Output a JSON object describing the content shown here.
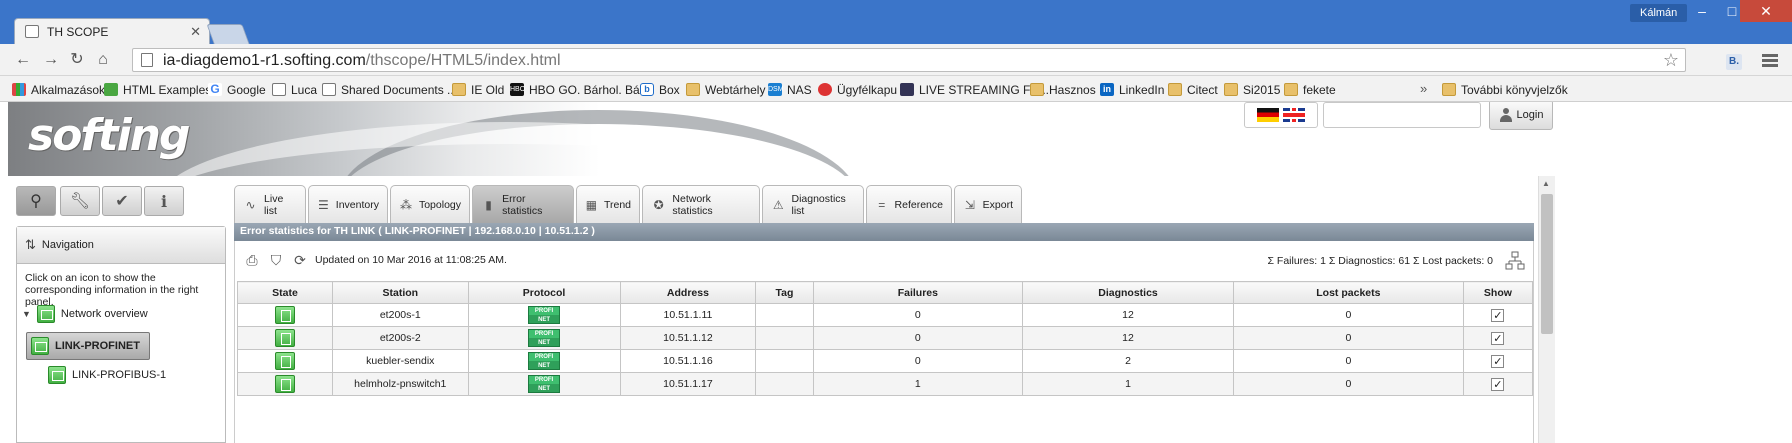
{
  "browser": {
    "tab_title": "TH SCOPE",
    "user": "Kálmán",
    "url_host": "ia-diagdemo1-r1.softing.com",
    "url_path": "/thscope/HTML5/index.html",
    "ext_label": "B.",
    "bookmarks": [
      {
        "label": "Alkalmazások",
        "icon": "apps-icon"
      },
      {
        "label": "HTML Examples",
        "icon": "w3-icon"
      },
      {
        "label": "Google",
        "icon": "google-icon"
      },
      {
        "label": "Luca",
        "icon": "page-icon"
      },
      {
        "label": "Shared Documents ...",
        "icon": "page-icon"
      },
      {
        "label": "IE Old",
        "icon": "folder-icon"
      },
      {
        "label": "HBO GO. Bárhol. Bár...",
        "icon": "hbo-icon"
      },
      {
        "label": "Box",
        "icon": "box-icon"
      },
      {
        "label": "Webtárhely",
        "icon": "folder-icon"
      },
      {
        "label": "NAS",
        "icon": "dsm-icon"
      },
      {
        "label": "Ügyfélkapu",
        "icon": "ugyfelkapu-icon"
      },
      {
        "label": "LIVE STREAMING FR...",
        "icon": "live-icon"
      },
      {
        "label": "Hasznos",
        "icon": "folder-icon"
      },
      {
        "label": "LinkedIn",
        "icon": "linkedin-icon"
      },
      {
        "label": "Citect",
        "icon": "folder-icon"
      },
      {
        "label": "Si2015",
        "icon": "folder-icon"
      },
      {
        "label": "fekete",
        "icon": "folder-icon"
      }
    ],
    "bookmarks_more": "»",
    "other_bookmarks": "További könyvjelzők"
  },
  "header": {
    "logo": "softing",
    "login_label": "Login"
  },
  "nav": {
    "title": "Navigation",
    "help": "Click on an icon to show the corresponding information in the right panel.",
    "tree": [
      {
        "label": "Network overview"
      },
      {
        "label": "LINK-PROFINET"
      },
      {
        "label": "LINK-PROFIBUS-1"
      }
    ]
  },
  "tabs": [
    {
      "label": "Live list",
      "icon": "pulse-icon"
    },
    {
      "label": "Inventory",
      "icon": "inventory-icon"
    },
    {
      "label": "Topology",
      "icon": "topology-icon"
    },
    {
      "label": "Error statistics",
      "icon": "bar-chart-icon"
    },
    {
      "label": "Trend",
      "icon": "trend-icon"
    },
    {
      "label": "Network statistics",
      "icon": "network-stats-icon"
    },
    {
      "label": "Diagnostics list",
      "icon": "warning-icon"
    },
    {
      "label": "Reference",
      "icon": "reference-icon"
    },
    {
      "label": "Export",
      "icon": "export-icon"
    }
  ],
  "content": {
    "title": "Error statistics for TH LINK ( LINK-PROFINET | 192.168.0.10 | 10.51.1.2 )",
    "updated": "Updated on 10 Mar 2016 at 11:08:25 AM.",
    "summary": "Σ Failures: 1 Σ Diagnostics: 61 Σ Lost packets: 0",
    "columns": [
      "State",
      "Station",
      "Protocol",
      "Address",
      "Tag",
      "Failures",
      "Diagnostics",
      "Lost packets",
      "Show"
    ],
    "protocol_label_top": "PROFI",
    "protocol_label_bottom": "NET",
    "rows": [
      {
        "station": "et200s-1",
        "address": "10.51.1.11",
        "tag": "",
        "failures": "0",
        "diagnostics": "12",
        "lost": "0",
        "show": "✓"
      },
      {
        "station": "et200s-2",
        "address": "10.51.1.12",
        "tag": "",
        "failures": "0",
        "diagnostics": "12",
        "lost": "0",
        "show": "✓"
      },
      {
        "station": "kuebler-sendix",
        "address": "10.51.1.16",
        "tag": "",
        "failures": "0",
        "diagnostics": "2",
        "lost": "0",
        "show": "✓"
      },
      {
        "station": "helmholz-pnswitch1",
        "address": "10.51.1.17",
        "tag": "",
        "failures": "1",
        "diagnostics": "1",
        "lost": "0",
        "show": "✓"
      }
    ]
  }
}
